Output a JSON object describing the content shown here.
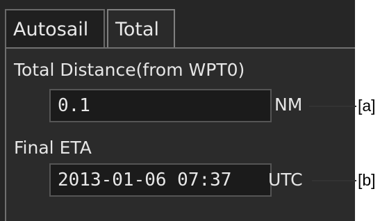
{
  "tabs": [
    {
      "label": "Autosail",
      "active": false
    },
    {
      "label": "Total",
      "active": true
    }
  ],
  "total_distance": {
    "label": "Total Distance(from WPT0)",
    "value": "0.1",
    "unit": "NM"
  },
  "final_eta": {
    "label": "Final ETA",
    "value": "2013-01-06 07:37",
    "unit": "UTC"
  },
  "callouts": {
    "a": "[a]",
    "b": "[b]"
  },
  "colors": {
    "panel_bg": "#2b2b2b",
    "field_bg": "#1b1b1b",
    "text": "#e6e6e6"
  }
}
